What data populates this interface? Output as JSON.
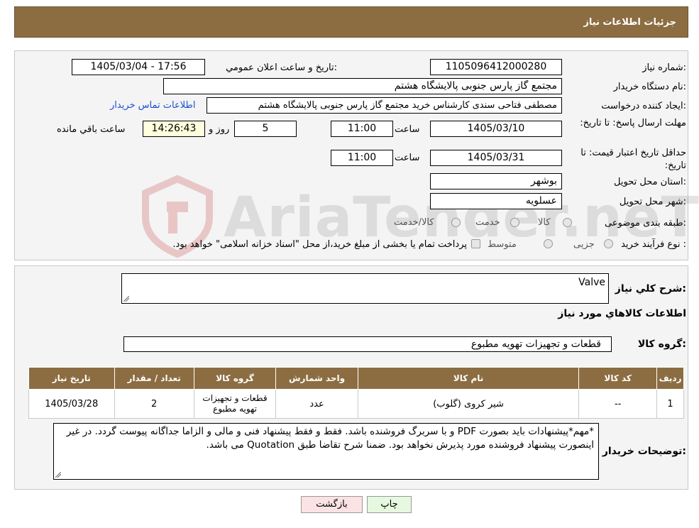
{
  "header": {
    "title": "جزئیات اطلاعات نیاز"
  },
  "form": {
    "need_number_label": "شماره نیاز:",
    "need_number": "1105096412000280",
    "announce_label": "تاریخ و ساعت اعلان عمومي:",
    "announce_value": "1405/03/04 - 17:56",
    "buyer_org_label": "نام دستگاه خریدار:",
    "buyer_org": "مجتمع گاز پارس جنوبی  پالایشگاه هشتم",
    "requester_label": "ایجاد کننده درخواست:",
    "requester": "مصطفی فتاحی سندی کارشناس خرید مجتمع گاز پارس جنوبی  پالایشگاه هشتم",
    "contact_link": "اطلاعات تماس خریدار",
    "deadline_label": "مهلت ارسال پاسخ: تا تاریخ:",
    "deadline_date": "1405/03/10",
    "time_label": "ساعت",
    "deadline_time": "11:00",
    "days_value": "5",
    "days_label": "روز و",
    "remaining_time": "14:26:43",
    "remaining_label": "ساعت باقي مانده",
    "validity_label": "حداقل تاریخ اعتبار قیمت: تا تاریخ:",
    "validity_date": "1405/03/31",
    "validity_time_label": "ساعت",
    "validity_time": "11:00",
    "province_label": "استان محل تحویل:",
    "province": "بوشهر",
    "city_label": "شهر محل تحویل:",
    "city": "عسلویه",
    "category_label": "طبقه بندی موضوعی:",
    "category_options": [
      "کالا",
      "خدمت",
      "کالا/خدمت"
    ],
    "process_label": "نوع فرآیند خرید :",
    "process_options": [
      "جزیی",
      "متوسط"
    ],
    "process_note": "پرداخت تمام یا بخشی از مبلغ خرید،از محل \"اسناد خزانه اسلامی\" خواهد بود."
  },
  "details": {
    "general_desc_label": "شرح کلي نیاز:",
    "general_desc": "Valve",
    "goods_info_title": "اطلاعات کالاهاي مورد نیاز",
    "goods_group_label": "گروه کالا:",
    "goods_group": "قطعات و تجهیزات تهویه مطبوع",
    "table": {
      "headers": [
        "ردیف",
        "کد کالا",
        "نام کالا",
        "واحد شمارش",
        "گروه کالا",
        "تعداد / مقدار",
        "تاریخ نیاز"
      ],
      "rows": [
        [
          "1",
          "--",
          "شیر کروی (گلوب)",
          "عدد",
          "قطعات و تجهیزات تهویه مطبوع",
          "2",
          "1405/03/28"
        ]
      ]
    },
    "buyer_notes_label": "توضیحات خریدار:",
    "buyer_notes": "*مهم*پیشنهادات باید بصورت PDF و با سربرگ فروشنده باشد. فقط و فقط پیشنهاد فنی و مالی و الزاما جداگانه پیوست گردد. در غیر اینصورت پیشنهاد فروشنده مورد پذیرش نخواهد بود. ضمنا شرح تقاضا طبق Quotation می باشد."
  },
  "buttons": {
    "print": "چاپ",
    "back": "بازگشت"
  },
  "watermark": {
    "text": "AriaTender.neT"
  },
  "colors": {
    "header_bg": "#8c6d42",
    "link": "#1a4fd6",
    "print_btn": "#e6f8e0",
    "back_btn": "#fbe3e3"
  }
}
